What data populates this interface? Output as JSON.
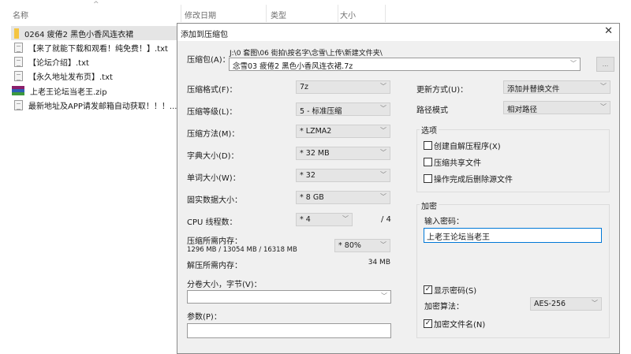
{
  "explorer": {
    "columns": [
      "名称",
      "修改日期",
      "类型",
      "大小"
    ],
    "files": [
      {
        "name": "0264 疲倦2 黑色小香风连衣裙",
        "icon": "folder-icon",
        "selected": true
      },
      {
        "name": "【来了就能下载和观看！纯免费！】.txt",
        "icon": "text-file-icon"
      },
      {
        "name": "【论坛介绍】.txt",
        "icon": "text-file-icon"
      },
      {
        "name": "【永久地址发布页】.txt",
        "icon": "text-file-icon"
      },
      {
        "name": "上老王论坛当老王.zip",
        "icon": "archive-icon"
      },
      {
        "name": "最新地址及APP请发邮箱自动获取！！！...",
        "icon": "text-file-icon"
      }
    ]
  },
  "dialog": {
    "title": "添加到压缩包",
    "archive_label": "压缩包(A)：",
    "archive_dir": "J:\\0 套图\\06 街拍\\按名字\\念雪\\上传\\新建文件夹\\",
    "archive_name": "念雪03 疲倦2 黑色小香风连衣裙.7z",
    "browse_label": "...",
    "left": {
      "format": {
        "label": "压缩格式(F)：",
        "value": "7z"
      },
      "level": {
        "label": "压缩等级(L)：",
        "value": "5 - 标准压缩"
      },
      "method": {
        "label": "压缩方法(M)：",
        "value": "* LZMA2"
      },
      "dict": {
        "label": "字典大小(D)：",
        "value": "* 32 MB"
      },
      "word": {
        "label": "单词大小(W)：",
        "value": "* 32"
      },
      "solid": {
        "label": "固实数据大小：",
        "value": "* 8 GB"
      },
      "cpu": {
        "label": "CPU 线程数：",
        "value": "* 4",
        "max": "/ 4"
      },
      "mem": {
        "label": "压缩所需内存：",
        "detail": "1296 MB / 13054 MB / 16318 MB",
        "value": "* 80%"
      },
      "decomp": {
        "label": "解压所需内存：",
        "value": "34 MB"
      },
      "split": {
        "label": "分卷大小，字节(V)：",
        "value": ""
      },
      "params": {
        "label": "参数(P)：",
        "value": ""
      }
    },
    "right": {
      "update": {
        "label": "更新方式(U)：",
        "value": "添加并替换文件"
      },
      "path": {
        "label": "路径模式",
        "value": "相对路径"
      },
      "options": {
        "legend": "选项",
        "items": [
          {
            "label": "创建自解压程序(X)",
            "checked": false
          },
          {
            "label": "压缩共享文件",
            "checked": false
          },
          {
            "label": "操作完成后删除源文件",
            "checked": false
          }
        ]
      },
      "encryption": {
        "legend": "加密",
        "password_label": "输入密码：",
        "password": "上老王论坛当老王",
        "show_password": {
          "label": "显示密码(S)",
          "checked": true
        },
        "method_label": "加密算法：",
        "method": "AES-256",
        "encrypt_names": {
          "label": "加密文件名(N)",
          "checked": true
        }
      }
    }
  }
}
